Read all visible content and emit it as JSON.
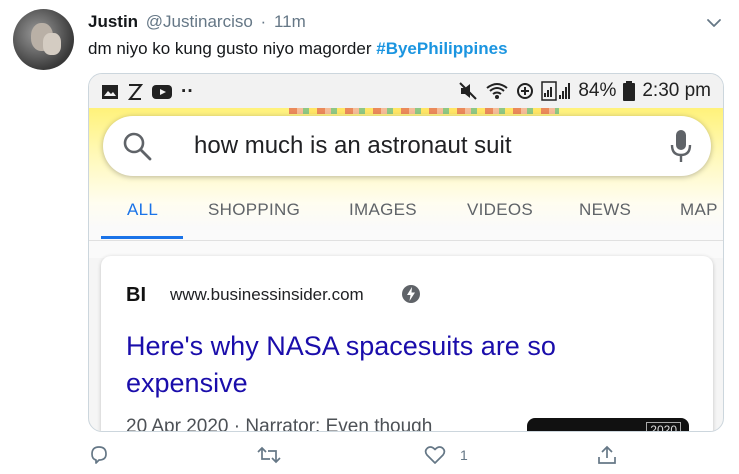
{
  "tweet": {
    "author_name": "Justin",
    "handle": "@Justinarciso",
    "separator": "·",
    "time": "11m",
    "text": "dm niyo ko kung gusto niyo magorder",
    "hashtag": "#ByePhilippines",
    "like_count": "1",
    "colors": {
      "hashtag": "#1b95e0",
      "secondary": "#657786"
    }
  },
  "screenshot": {
    "statusbar": {
      "dots": "··",
      "battery": "84%",
      "clock": "2:30 pm",
      "icons": [
        "image-icon",
        "z-icon",
        "youtube-icon",
        "mute-icon",
        "wifi-icon",
        "data-saver-icon",
        "signal-icon",
        "battery-icon"
      ]
    },
    "search": {
      "query": "how much is an astronaut suit"
    },
    "tabs": [
      "ALL",
      "SHOPPING",
      "IMAGES",
      "VIDEOS",
      "NEWS",
      "MAP"
    ],
    "active_tab": "ALL",
    "result": {
      "site_logo": "BI",
      "url": "www.businessinsider.com",
      "title": "Here's why NASA spacesuits are so expensive",
      "snippet": "20 Apr 2020 · Narrator: Even though",
      "thumb_label": "2020",
      "colors": {
        "title": "#1a0dab",
        "tab_active": "#1a73e8"
      }
    }
  }
}
